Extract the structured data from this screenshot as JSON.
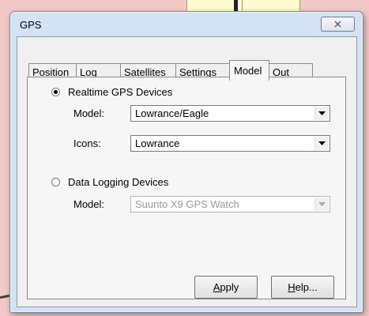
{
  "window": {
    "title": "GPS",
    "close_icon": "close-icon"
  },
  "tabs": [
    {
      "label": "Position",
      "selected": false
    },
    {
      "label": "Log",
      "selected": false
    },
    {
      "label": "Satellites",
      "selected": false
    },
    {
      "label": "Settings",
      "selected": false
    },
    {
      "label": "Model",
      "selected": true
    },
    {
      "label": "Out",
      "selected": false
    }
  ],
  "realtime": {
    "label": "Realtime GPS Devices",
    "checked": true,
    "model_label": "Model:",
    "model_value": "Lowrance/Eagle",
    "icons_label": "Icons:",
    "icons_value": "Lowrance"
  },
  "logging": {
    "label": "Data Logging Devices",
    "checked": false,
    "model_label": "Model:",
    "model_value": "Suunto X9 GPS Watch",
    "disabled": true
  },
  "buttons": {
    "apply": {
      "label": "Apply",
      "mnemonic": "A"
    },
    "help": {
      "label": "Help...",
      "mnemonic": "H"
    }
  }
}
